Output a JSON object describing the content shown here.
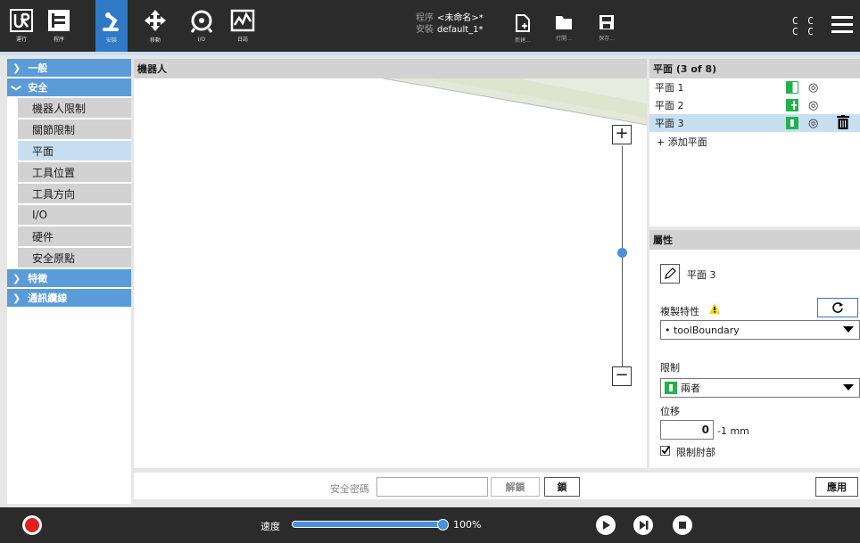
{
  "header": {
    "nav": [
      {
        "label": "運行"
      },
      {
        "label": "程序"
      },
      {
        "label": "安裝"
      },
      {
        "label": "移動"
      },
      {
        "label": "I/O"
      },
      {
        "label": "日誌"
      }
    ],
    "program_key": "程序",
    "program_value": "<未命名>*",
    "install_key": "安裝",
    "install_value": "default_1*",
    "file_buttons": [
      {
        "label": "新建..."
      },
      {
        "label": "打開..."
      },
      {
        "label": "保存..."
      }
    ],
    "cc_top": "C C",
    "cc_bottom": "C C"
  },
  "leftnav": {
    "general": "一般",
    "safety": "安全",
    "safety_items": [
      {
        "label": "機器人限制"
      },
      {
        "label": "關節限制"
      },
      {
        "label": "平面"
      },
      {
        "label": "工具位置"
      },
      {
        "label": "工具方向"
      },
      {
        "label": "I/O"
      },
      {
        "label": "硬件"
      },
      {
        "label": "安全原點"
      }
    ],
    "features": "特徵",
    "comms": "通訊纜線"
  },
  "robot": {
    "title": "機器人",
    "zoom_in": "+",
    "zoom_out": "−"
  },
  "planes": {
    "title": "平面 (3 of 8)",
    "items": [
      {
        "label": "平面 1"
      },
      {
        "label": "平面 2"
      },
      {
        "label": "平面 3"
      }
    ],
    "add": "+ 添加平面"
  },
  "props": {
    "title": "屬性",
    "name": "平面 3",
    "copy_label": "複製特性",
    "copy_value": "• toolBoundary",
    "restrict_label": "限制",
    "restrict_value": "兩者",
    "offset_label": "位移",
    "offset_value": "0",
    "offset_unit": "-1 mm",
    "restrict_elbow": "限制肘部"
  },
  "bottom": {
    "password_label": "安全密碼",
    "unlock": "解鎖",
    "lock": "鎖",
    "apply": "應用"
  },
  "footer": {
    "speed_label": "速度",
    "speed_value": "100%",
    "speed_fraction": 1.0
  },
  "colors": {
    "accent": "#2f79c6",
    "nav_blue": "#5a9bd8",
    "selected": "#c8dff2",
    "green": "#22b14c"
  }
}
